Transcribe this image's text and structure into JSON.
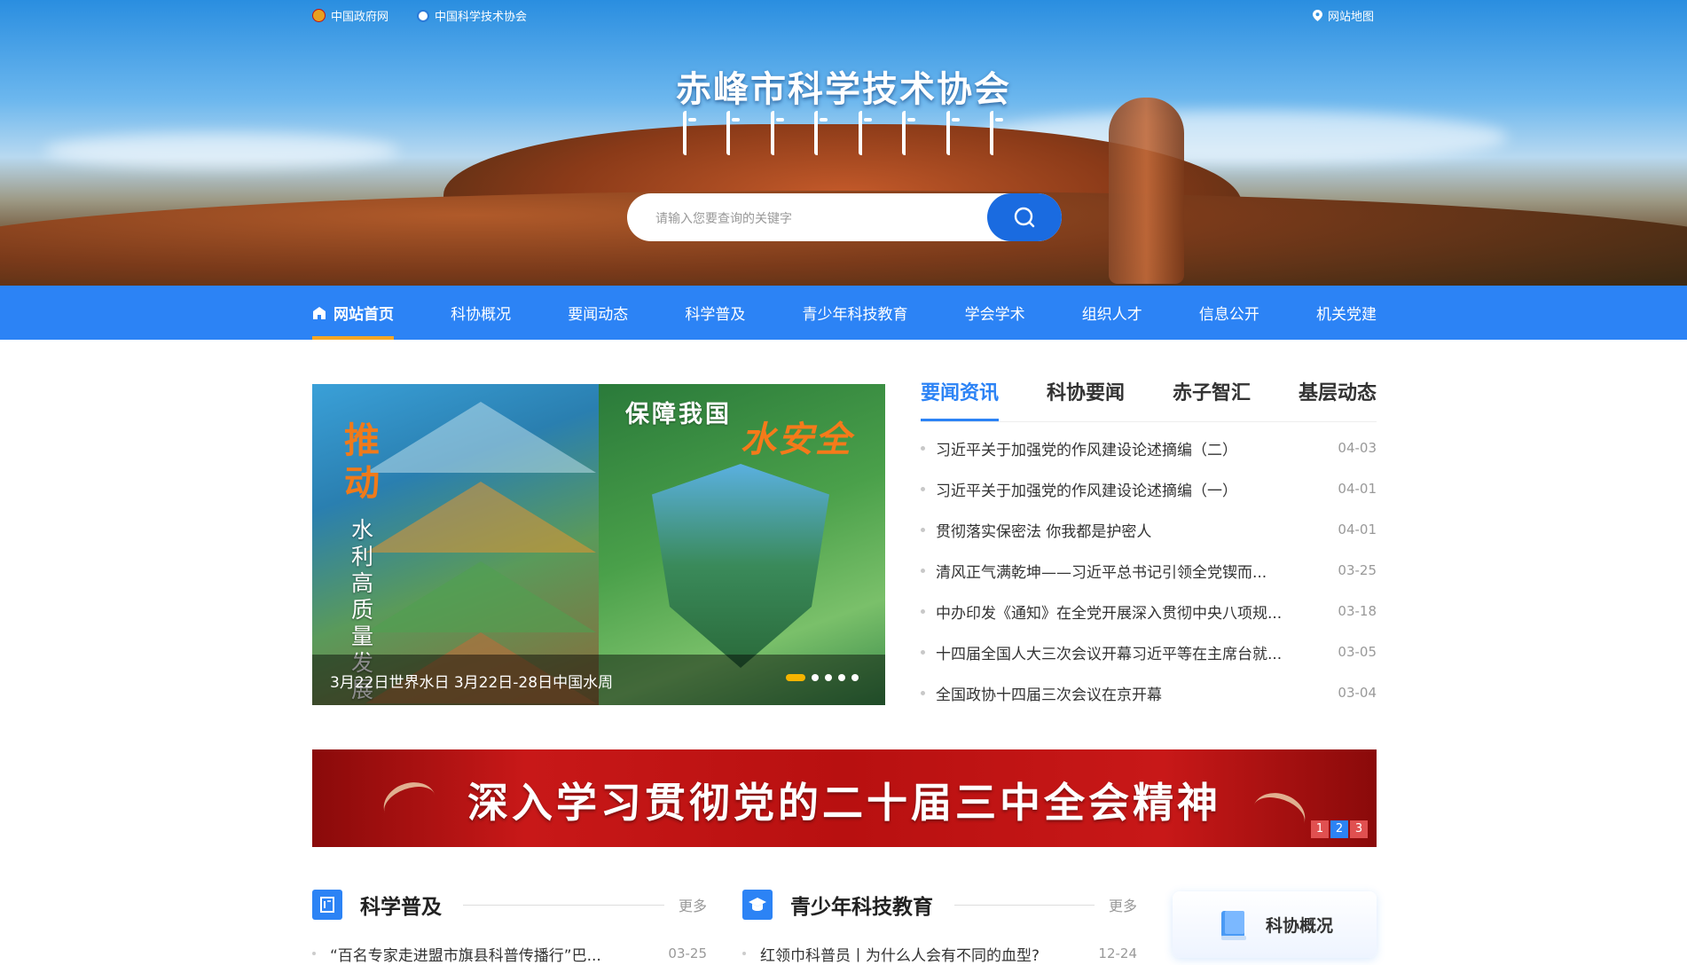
{
  "topbar": {
    "left_links": [
      "中国政府网",
      "中国科学技术协会"
    ],
    "right_link": "网站地图"
  },
  "header": {
    "title": "赤峰市科学技术协会",
    "search_placeholder": "请输入您要查询的关键字"
  },
  "nav": {
    "items": [
      "网站首页",
      "科协概况",
      "要闻动态",
      "科学普及",
      "青少年科技教育",
      "学会学术",
      "组织人才",
      "信息公开",
      "机关党建"
    ],
    "active_index": 0
  },
  "slider": {
    "caption": "3月22日世界水日 3月22日-28日中国水周",
    "dot_count": 5,
    "active_dot": 0,
    "left_poster_big": "推动",
    "left_poster_vertical": "水利高质量发展",
    "right_poster_line1": "保障我国",
    "right_poster_line2": "水安全"
  },
  "news": {
    "tabs": [
      "要闻资讯",
      "科协要闻",
      "赤子智汇",
      "基层动态"
    ],
    "active_tab": 0,
    "items": [
      {
        "title": "习近平关于加强党的作风建设论述摘编（二）",
        "date": "04-03"
      },
      {
        "title": "习近平关于加强党的作风建设论述摘编（一）",
        "date": "04-01"
      },
      {
        "title": "贯彻落实保密法 你我都是护密人",
        "date": "04-01"
      },
      {
        "title": "清风正气满乾坤——习近平总书记引领全党锲而...",
        "date": "03-25"
      },
      {
        "title": "中办印发《通知》在全党开展深入贯彻中央八项规...",
        "date": "03-18"
      },
      {
        "title": "十四届全国人大三次会议开幕习近平等在主席台就...",
        "date": "03-05"
      },
      {
        "title": "全国政协十四届三次会议在京开幕",
        "date": "03-04"
      }
    ]
  },
  "banner": {
    "text": "深入学习贯彻党的二十届三中全会精神",
    "pages": [
      "1",
      "2",
      "3"
    ],
    "active_page": 1
  },
  "sections": [
    {
      "title": "科学普及",
      "more": "更多",
      "first_item": {
        "title": "“百名专家走进盟市旗县科普传播行”巴...",
        "date": "03-25"
      }
    },
    {
      "title": "青少年科技教育",
      "more": "更多",
      "first_item": {
        "title": "红领巾科普员丨为什么人会有不同的血型?",
        "date": "12-24"
      }
    }
  ],
  "side_card": {
    "label": "科协概况"
  },
  "colors": {
    "primary_blue": "#2c83f5",
    "accent_orange": "#f5a623",
    "banner_red": "#c81818"
  }
}
